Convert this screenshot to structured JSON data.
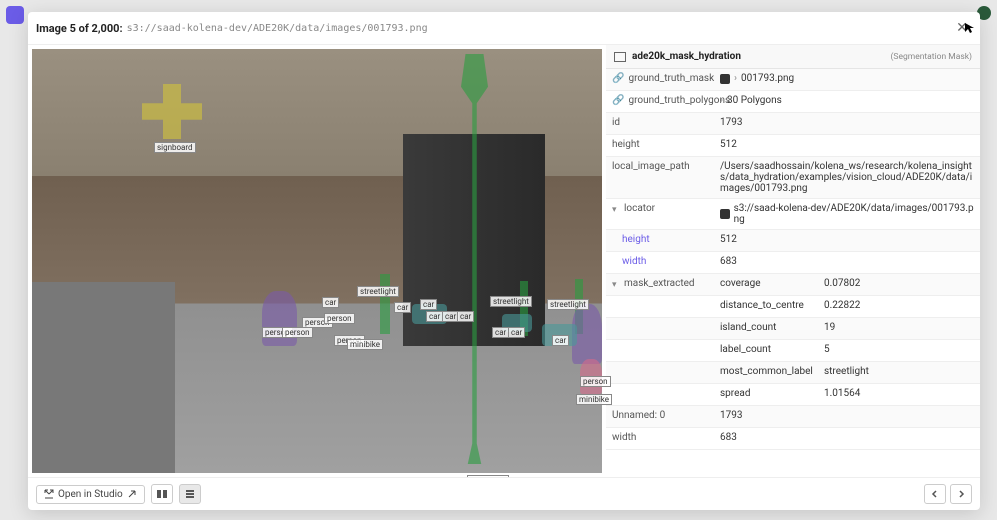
{
  "header": {
    "title": "Image 5 of 2,000:",
    "path": "s3://saad-kolena-dev/ADE20K/data/images/001793.png"
  },
  "detail": {
    "title": "ade20k_mask_hydration",
    "tag": "(Segmentation Mask)",
    "rows": {
      "gt_mask_key": "ground_truth_mask",
      "gt_mask_val": "001793.png",
      "gt_poly_key": "ground_truth_polygons",
      "gt_poly_val": "30 Polygons",
      "id_key": "id",
      "id_val": "1793",
      "height_key": "height",
      "height_val": "512",
      "lip_key": "local_image_path",
      "lip_val": "/Users/saadhossain/kolena_ws/research/kolena_insights/data_hydration/examples/vision_cloud/ADE20K/data/images/001793.png",
      "loc_key": "locator",
      "loc_val": "s3://saad-kolena-dev/ADE20K/data/images/001793.png",
      "loc_h_key": "height",
      "loc_h_val": "512",
      "loc_w_key": "width",
      "loc_w_val": "683",
      "me_key": "mask_extracted",
      "cov_key": "coverage",
      "cov_val": "0.07802",
      "dtc_key": "distance_to_centre",
      "dtc_val": "0.22822",
      "ic_key": "island_count",
      "ic_val": "19",
      "lc_key": "label_count",
      "lc_val": "5",
      "mcl_key": "most_common_label",
      "mcl_val": "streetlight",
      "spr_key": "spread",
      "spr_val": "1.01564",
      "un_key": "Unnamed: 0",
      "un_val": "1793",
      "w_key": "width",
      "w_val": "683"
    }
  },
  "footer": {
    "open": "Open in Studio"
  },
  "ann": {
    "signboard": "signboard",
    "streetlight": "streetlight",
    "car": "car",
    "person": "person",
    "minibike": "minibike"
  }
}
